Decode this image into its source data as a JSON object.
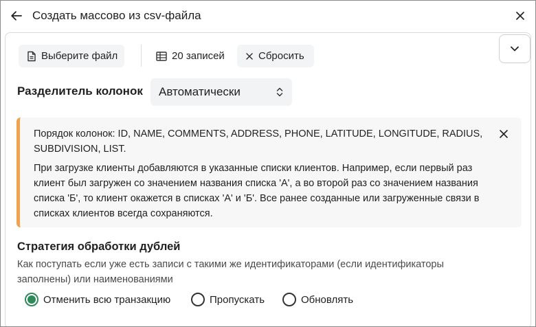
{
  "dialog": {
    "title": "Создать массово из csv-файла"
  },
  "toolbar": {
    "choose_file_label": "Выберите файл",
    "records_label": "20 записей",
    "reset_label": "Сбросить"
  },
  "separator": {
    "label": "Разделитель колонок",
    "selected": "Автоматически"
  },
  "info": {
    "columns_text": "Порядок колонок: ID, NAME, COMMENTS, ADDRESS, PHONE, LATITUDE, LONGITUDE, RADIUS, SUBDIVISION, LIST.",
    "description": "При загрузке клиенты добавляются в указанные списки клиентов. Например, если первый раз клиент был загружен со значением названия списка 'А', а во второй раз со значением названия списка 'Б', то клиент окажется в списках 'А' и 'Б'. Все ранее созданные или загруженные связи в списках клиентов всегда сохраняются.",
    "accent_color": "#f0a24c"
  },
  "duplicates": {
    "title": "Стратегия обработки дублей",
    "description": "Как поступать если уже есть записи с такими же идентификаторами (если идентификаторы заполнены) или наименованиями",
    "options": [
      {
        "label": "Отменить всю транзакцию",
        "checked": true
      },
      {
        "label": "Пропускать",
        "checked": false
      },
      {
        "label": "Обновлять",
        "checked": false
      }
    ],
    "accent_color": "#2f8a5b"
  },
  "icons": {
    "back": "arrow-left-icon",
    "close": "close-icon",
    "collapse": "chevron-down-icon",
    "file": "file-icon",
    "table": "table-icon",
    "reset": "x-icon",
    "select": "up-down-chevron-icon",
    "alert_close": "close-icon"
  }
}
